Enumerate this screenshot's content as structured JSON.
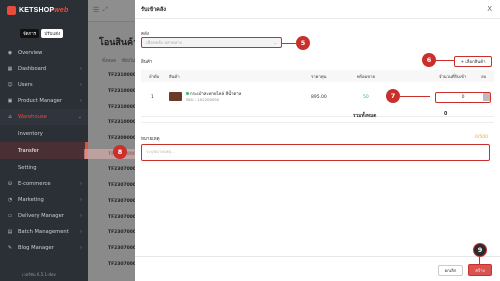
{
  "sidebar": {
    "logo_text": "KETSHOP",
    "logo_accent": "web",
    "user_chip": "จัดการ",
    "user_chip2": "ปรับแต่ง",
    "items": [
      {
        "label": "Overview",
        "icon": "overview-icon"
      },
      {
        "label": "Dashboard",
        "icon": "dashboard-icon"
      },
      {
        "label": "Users",
        "icon": "users-icon"
      },
      {
        "label": "Product Manager",
        "icon": "product-icon"
      },
      {
        "label": "Warehouse",
        "icon": "warehouse-icon"
      }
    ],
    "sub_items": [
      {
        "label": "Inventory"
      },
      {
        "label": "Transfer"
      },
      {
        "label": "Setting"
      }
    ],
    "items_after": [
      {
        "label": "E-commerce",
        "icon": "ecommerce-icon"
      },
      {
        "label": "Marketing",
        "icon": "marketing-icon"
      },
      {
        "label": "Delivery Manager",
        "icon": "delivery-icon"
      },
      {
        "label": "Batch Management",
        "icon": "batch-icon"
      },
      {
        "label": "Blog Manager",
        "icon": "blog-icon"
      }
    ],
    "version": "เวอร์ชัน 6.5.1-dev"
  },
  "background": {
    "title": "โอนสินค้า",
    "head1": "ทั้งหมด",
    "head2": "ที่ยังไม่",
    "rows": [
      "TF23100000",
      "TF23100000",
      "TF23100000",
      "TF23100000",
      "TF23090000",
      "TF23070000",
      "TF23070000",
      "TF23070000",
      "TF23070000",
      "TF23070000",
      "TF23070000",
      "TF23070000",
      "TF23070000"
    ]
  },
  "modal": {
    "title": "รับเข้าคลัง",
    "close": "X",
    "warehouse_label": "คลัง",
    "warehouse_placeholder": "เลือกคลัง ปลายทาง",
    "products_label": "สินค้า",
    "add_button": "+ เลือกสินค้า",
    "columns": [
      "ลำดับ",
      "สินค้า",
      "ราคาทุน",
      "พร้อมขาย",
      "จำนวนที่รับเข้า",
      "ลบ"
    ],
    "rows": [
      {
        "index": "1",
        "name": "กระเป๋าสะพายไหล่ สีน้ำตาล",
        "sku": "SKU : 1X2200050",
        "cost": "895.00",
        "available": "50",
        "qty": "0"
      }
    ],
    "total_label": "รวมทั้งหมด",
    "total_value": "0",
    "note_label": "หมายเหตุ",
    "note_count": "0/500",
    "note_placeholder": "ระบุหมายเหตุ...",
    "cancel_button": "ยกเลิก",
    "create_button": "สร้าง"
  },
  "callouts": [
    "5",
    "6",
    "7",
    "8",
    "9"
  ],
  "colors": {
    "accent": "#c9302c",
    "sidebar_bg": "#2b2f36",
    "available_green": "#3cb371",
    "note_count": "#e8a33c"
  }
}
